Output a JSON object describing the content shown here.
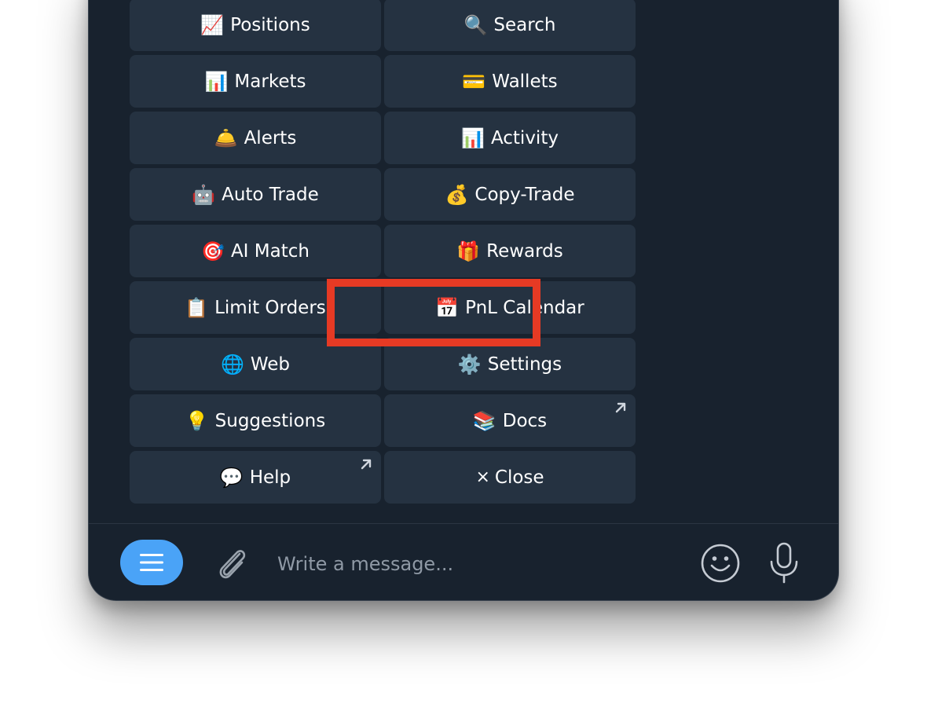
{
  "keyboard": {
    "buttons": [
      {
        "label": "Positions",
        "emoji": "📈"
      },
      {
        "label": "Search",
        "emoji": "🔍"
      },
      {
        "label": "Markets",
        "emoji": "📊"
      },
      {
        "label": "Wallets",
        "emoji": "💳"
      },
      {
        "label": "Alerts",
        "emoji": "🛎️"
      },
      {
        "label": "Activity",
        "emoji": "📊"
      },
      {
        "label": "Auto Trade",
        "emoji": "🤖"
      },
      {
        "label": "Copy-Trade",
        "emoji": "💰"
      },
      {
        "label": "AI Match",
        "emoji": "🎯"
      },
      {
        "label": "Rewards",
        "emoji": "🎁"
      },
      {
        "label": "Limit Orders",
        "emoji": "📋"
      },
      {
        "label": "PnL Calendar",
        "emoji": "📅"
      },
      {
        "label": "Web",
        "emoji": "🌐"
      },
      {
        "label": "Settings",
        "emoji": "⚙️"
      },
      {
        "label": "Suggestions",
        "emoji": "💡"
      },
      {
        "label": "Docs",
        "emoji": "📚",
        "external": true
      },
      {
        "label": "Help",
        "emoji": "💬",
        "external": true
      },
      {
        "label": "Close",
        "emoji": "×"
      }
    ]
  },
  "composer": {
    "placeholder": "Write a message...",
    "menu_icon": "hamburger-icon",
    "attach_icon": "paperclip-icon",
    "emoji_icon": "smiley-icon",
    "mic_icon": "microphone-icon"
  },
  "colors": {
    "background": "#18222e",
    "button": "#253241",
    "accent": "#4aa3f7",
    "highlight": "#e63a24"
  }
}
